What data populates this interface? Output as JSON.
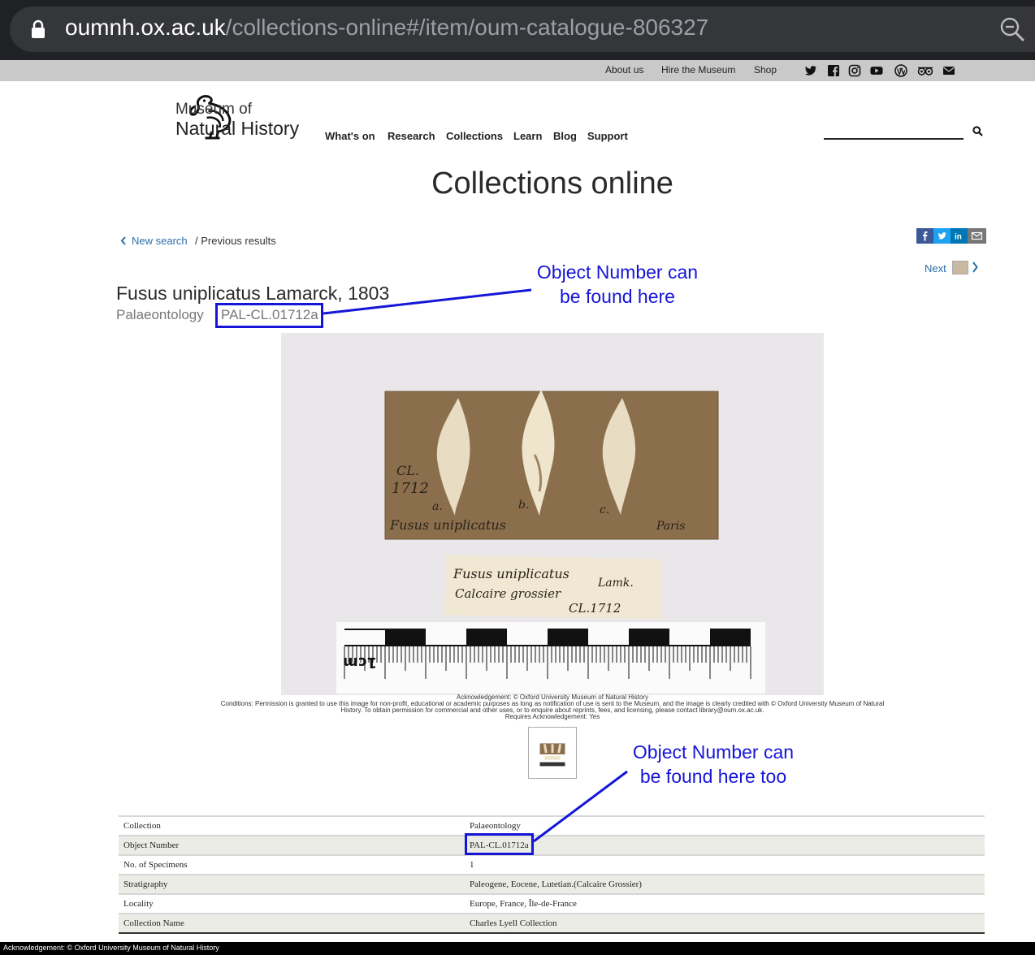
{
  "browser": {
    "url_host": "oumnh.ox.ac.uk",
    "url_path": "/collections-online#/item/oum-catalogue-806327"
  },
  "utility_links": [
    "About us",
    "Hire the Museum",
    "Shop"
  ],
  "social_icons": [
    "twitter-icon",
    "facebook-icon",
    "instagram-icon",
    "youtube-icon",
    "wordpress-icon",
    "tripadvisor-icon",
    "email-icon"
  ],
  "logo": {
    "line1": "Museum of",
    "line2": "Natural History"
  },
  "nav": [
    "What's on",
    "Research",
    "Collections",
    "Learn",
    "Blog",
    "Support"
  ],
  "page_title": "Collections online",
  "breadcrumb": {
    "back": "New search",
    "prev": "/ Previous results"
  },
  "share_icons": [
    "facebook-share-icon",
    "twitter-share-icon",
    "linkedin-share-icon",
    "email-share-icon"
  ],
  "next_label": "Next",
  "object": {
    "title": "Fusus uniplicatus Lamarck, 1803",
    "department": "Palaeontology",
    "number": "PAL-CL.01712a"
  },
  "annotations": {
    "first_line1": "Object Number can",
    "first_line2": "be found here",
    "second_line1": "Object Number can",
    "second_line2": "be found here too",
    "color": "#1515d8"
  },
  "acknowledgement": {
    "line1": "Acknowledgement: © Oxford University Museum of Natural History",
    "line2": "Conditions: Permission is granted to use this image for non-profit, educational or academic purposes as long as notification of use is sent to the Museum, and the image is clearly credited with © Oxford University Museum of Natural",
    "line3": "History. To obtain permission for commercial and other uses, or to enquire about reprints, fees, and licensing, please contact library@oum.ox.ac.uk.",
    "line4": "Requires Acknowledgement: Yes"
  },
  "details": [
    {
      "label": "Collection",
      "value": "Palaeontology"
    },
    {
      "label": "Object Number",
      "value": "PAL-CL.01712a"
    },
    {
      "label": "No. of Specimens",
      "value": "1"
    },
    {
      "label": "Stratigraphy",
      "value": "Paleogene, Eocene, Lutetian.(Calcaire Grossier)"
    },
    {
      "label": "Locality",
      "value": "Europe, France, Île-de-France"
    },
    {
      "label": "Collection Name",
      "value": "Charles Lyell Collection"
    }
  ],
  "footer": "Acknowledgement: © Oxford University Museum of Natural History"
}
